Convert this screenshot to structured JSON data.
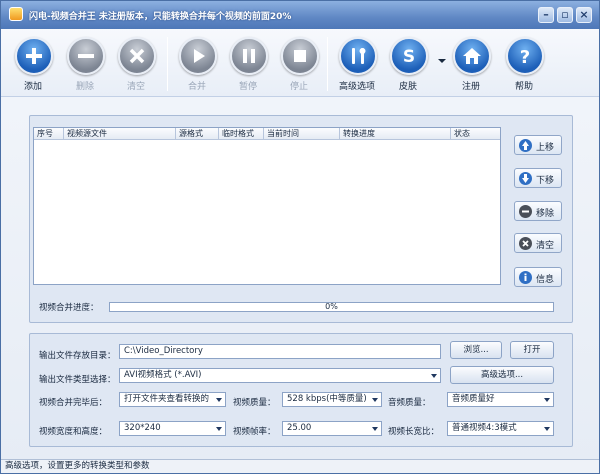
{
  "window": {
    "title": "闪电-视频合并王  未注册版本，只能转换合并每个视频的前面20%"
  },
  "toolbar": {
    "add": "添加",
    "delete": "删除",
    "clear": "清空",
    "merge": "合并",
    "pause": "暂停",
    "stop": "停止",
    "advanced": "高级选项",
    "skin": "皮肤",
    "register": "注册",
    "help": "帮助"
  },
  "list": {
    "columns": [
      "序号",
      "视频源文件",
      "源格式",
      "临时格式",
      "当前时间",
      "转换进度",
      "状态"
    ]
  },
  "side": {
    "up": "上移",
    "down": "下移",
    "remove": "移除",
    "clear": "清空",
    "info": "信息"
  },
  "progress": {
    "label": "视频合并进度：",
    "text": "0%",
    "value": 0
  },
  "settings": {
    "out_dir_label": "输出文件存放目录：",
    "out_dir_value": "C:\\Video_Directory",
    "browse": "浏览...",
    "open": "打开",
    "type_label": "输出文件类型选择：",
    "type_value": "AVI视频格式 (*.AVI)",
    "advanced_btn": "高级选项...",
    "after_label": "视频合并完毕后：",
    "after_value": "打开文件夹查看转换的",
    "vq_label": "视频质量：",
    "vq_value": "528 kbps(中等质量)",
    "aq_label": "音频质量：",
    "aq_value": "音频质量好",
    "size_label": "视频宽度和高度：",
    "size_value": "320*240",
    "fps_label": "视频帧率：",
    "fps_value": "25.00",
    "ratio_label": "视频长宽比：",
    "ratio_value": "普通视频4:3模式"
  },
  "status": {
    "text": "高级选项，设置更多的转换类型和参数"
  }
}
